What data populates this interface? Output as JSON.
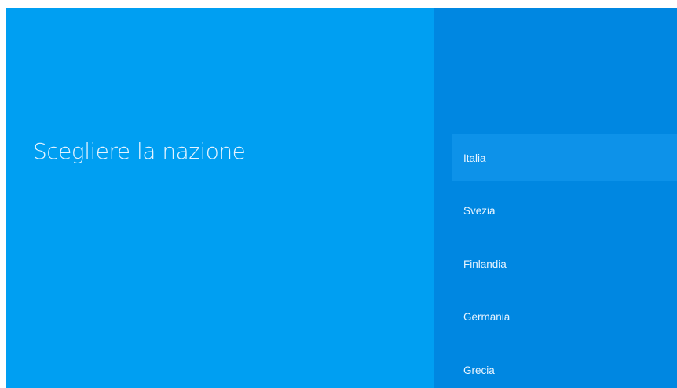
{
  "colors": {
    "left_background": "#009ff2",
    "right_background": "#0087e1",
    "selected_item": "#0d92e9",
    "text": "#eaf5ff"
  },
  "header": {
    "title": "Scegliere la nazione"
  },
  "country_list": {
    "selected_index": 0,
    "items": [
      {
        "label": "Italia"
      },
      {
        "label": "Svezia"
      },
      {
        "label": "Finlandia"
      },
      {
        "label": "Germania"
      },
      {
        "label": "Grecia"
      }
    ]
  }
}
